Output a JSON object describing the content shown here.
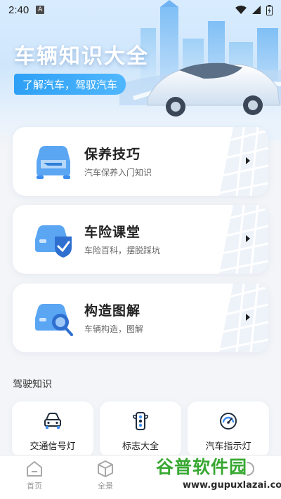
{
  "status_bar": {
    "time": "2:40",
    "notification": "A"
  },
  "hero": {
    "title": "车辆知识大全",
    "subtitle": "了解汽车，驾驭汽车"
  },
  "cards": [
    {
      "title": "保养技巧",
      "subtitle": "汽车保养入门知识",
      "icon": "car-maintenance-icon"
    },
    {
      "title": "车险课堂",
      "subtitle": "车险百科，摆脱踩坑",
      "icon": "car-insurance-icon"
    },
    {
      "title": "构造图解",
      "subtitle": "车辆构造，图解",
      "icon": "car-structure-icon"
    }
  ],
  "section": {
    "title": "驾驶知识"
  },
  "driving_items": [
    {
      "label": "交通信号灯",
      "icon": "car-front-icon"
    },
    {
      "label": "标志大全",
      "icon": "traffic-light-icon"
    },
    {
      "label": "汽车指示灯",
      "icon": "gauge-icon"
    }
  ],
  "tabbar": {
    "items": [
      {
        "label": "首页"
      },
      {
        "label": "全景"
      }
    ]
  },
  "watermark": {
    "text": "谷普软件园",
    "url": "www.gupuxlazai.com"
  },
  "colors": {
    "accent": "#2ea0f5",
    "icon_blue": "#3d8ef0",
    "watermark_green": "#38a832"
  }
}
